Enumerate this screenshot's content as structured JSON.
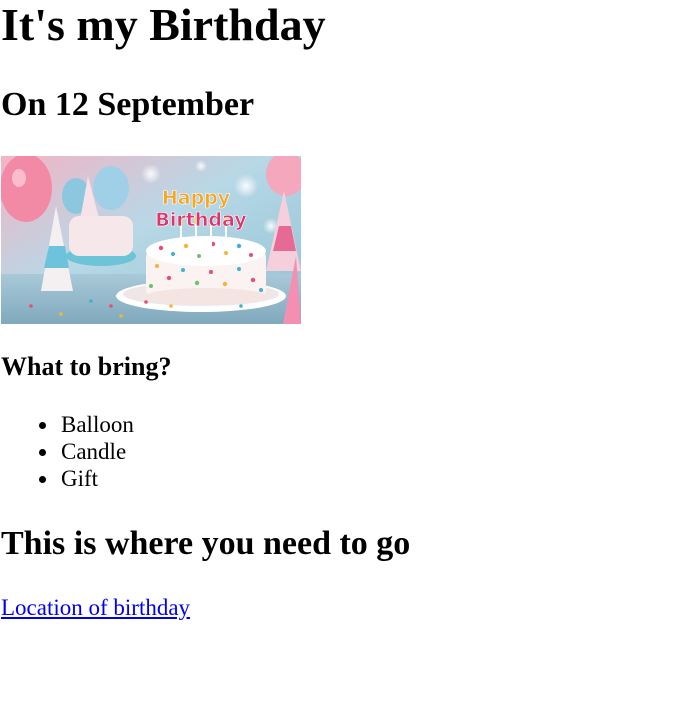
{
  "page": {
    "title": "It's my Birthday",
    "date_line": "On 12 September"
  },
  "image": {
    "icon": "birthday-cake-photo",
    "sign_line1": "Happy",
    "sign_line2": "Birthday"
  },
  "bring": {
    "heading": "What to bring?",
    "items": [
      "Balloon",
      "Candle",
      "Gift"
    ]
  },
  "location": {
    "heading": "This is where you need to go",
    "link_text": "Location of birthday"
  },
  "colors": {
    "link": "#0000ee",
    "text": "#000000",
    "background": "#ffffff"
  }
}
